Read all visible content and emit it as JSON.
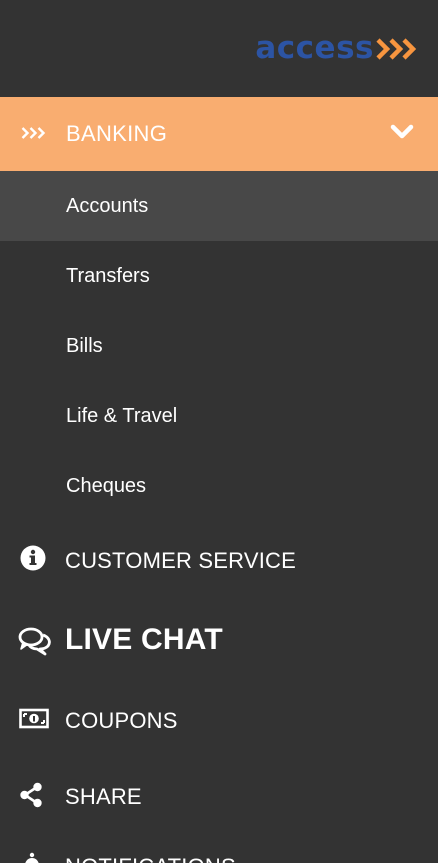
{
  "brand": {
    "logo_text": "access",
    "logo_color": "#2c54a4",
    "chevron_color": "#f7953f"
  },
  "colors": {
    "background": "#333333",
    "active_header": "#f9ad70",
    "active_subitem": "#484848",
    "text": "#ffffff"
  },
  "menu": {
    "banking": {
      "label": "BANKING",
      "icon": "triple-chevron-icon",
      "expanded": true
    },
    "sub_items": [
      {
        "label": "Accounts",
        "active": true
      },
      {
        "label": "Transfers"
      },
      {
        "label": "Bills"
      },
      {
        "label": "Life & Travel"
      },
      {
        "label": "Cheques"
      }
    ],
    "items": [
      {
        "label": "CUSTOMER SERVICE",
        "icon": "info-icon"
      },
      {
        "label": "LIVE CHAT",
        "icon": "chat-bubbles-icon"
      },
      {
        "label": "COUPONS",
        "icon": "money-icon"
      },
      {
        "label": "SHARE",
        "icon": "share-icon"
      },
      {
        "label": "NOTIFICATIONS",
        "icon": "bell-icon"
      }
    ]
  }
}
